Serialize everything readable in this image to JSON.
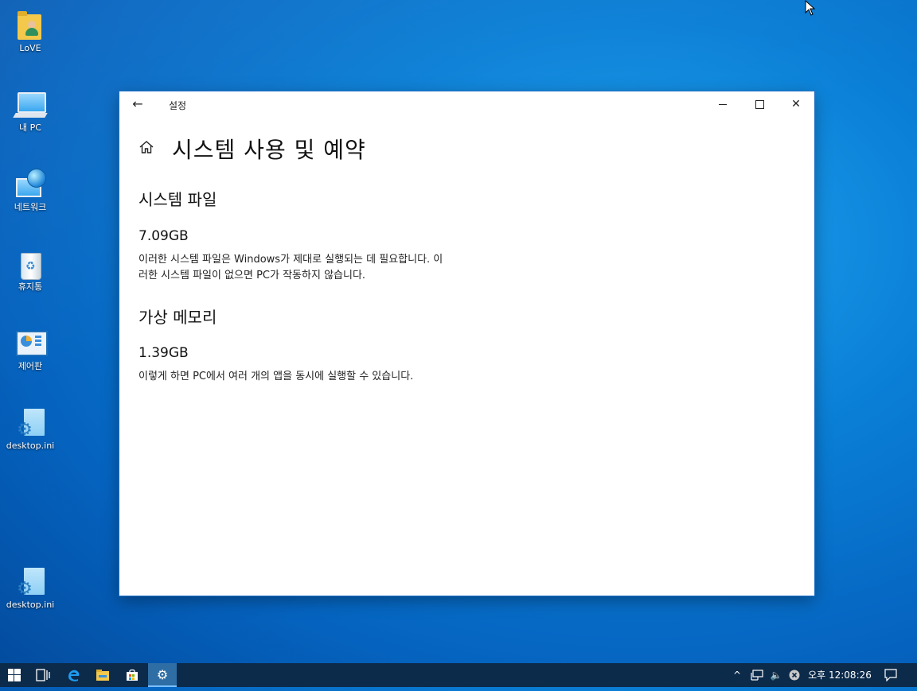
{
  "desktop": {
    "icons": [
      {
        "label": "LoVE",
        "icon": "user-folder-icon"
      },
      {
        "label": "내 PC",
        "icon": "computer-icon"
      },
      {
        "label": "네트워크",
        "icon": "network-icon"
      },
      {
        "label": "휴지통",
        "icon": "recycle-bin-icon"
      },
      {
        "label": "제어판",
        "icon": "control-panel-icon"
      },
      {
        "label": "desktop.ini",
        "icon": "settings-file-icon"
      },
      {
        "label": "desktop.ini",
        "icon": "settings-file-icon"
      }
    ]
  },
  "window": {
    "title": "설정",
    "back_icon": "←",
    "controls": {
      "minimize": "minimize-icon",
      "maximize": "maximize-icon",
      "close": "✕"
    }
  },
  "page": {
    "title": "시스템 사용 및 예약",
    "sections": [
      {
        "title": "시스템 파일",
        "size": "7.09GB",
        "description_line1": "이러한 시스템 파일은 Windows가 제대로 실행되는 데 필요합니다. 이",
        "description_line2": "러한 시스템 파일이 없으면 PC가 작동하지 않습니다."
      },
      {
        "title": "가상 메모리",
        "size": "1.39GB",
        "description_line1": "이렇게 하면 PC에서 여러 개의 앱을 동시에 실행할 수 있습니다."
      }
    ]
  },
  "taskbar": {
    "items": [
      "start-icon",
      "task-view-icon",
      "edge-icon",
      "file-explorer-icon",
      "store-icon",
      "settings-icon"
    ],
    "tray": [
      "chevron-up-icon",
      "network-icon",
      "volume-icon",
      "error-icon",
      "notification-icon"
    ],
    "tray_glyphs": {
      "chevron": "^",
      "volume": "🔈",
      "notification": "🗨"
    },
    "clock": "오후 12:08:26"
  }
}
